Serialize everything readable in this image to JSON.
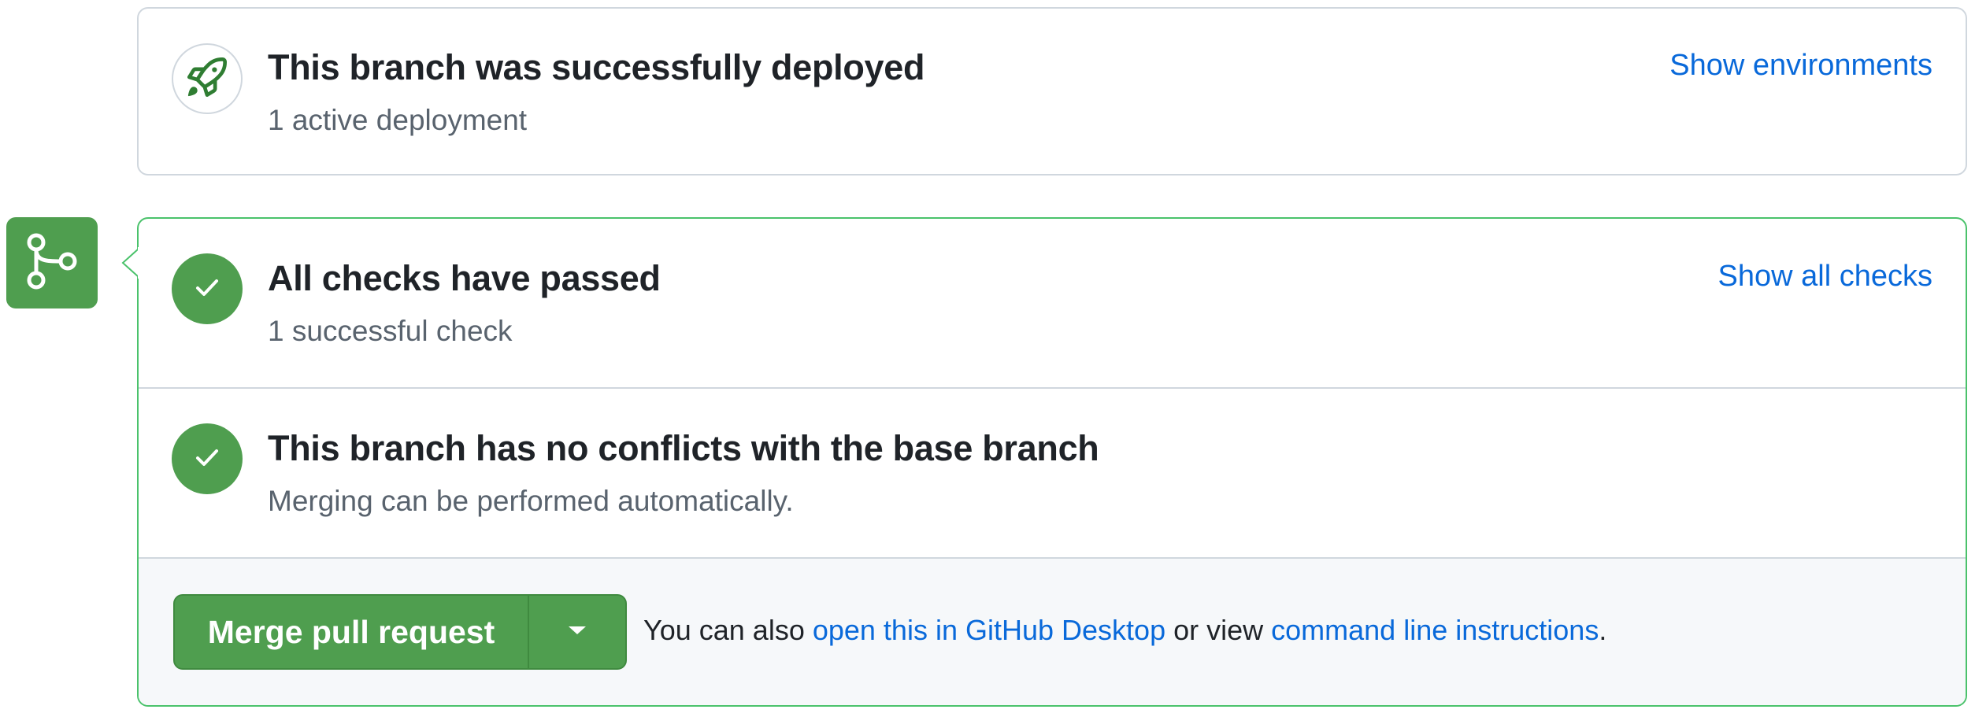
{
  "deployment": {
    "title": "This branch was successfully deployed",
    "subtitle": "1 active deployment",
    "link": "Show environments",
    "icon": "rocket-icon"
  },
  "merge_box": {
    "branch_icon": "git-branch-icon",
    "checks": {
      "title": "All checks have passed",
      "subtitle": "1 successful check",
      "link": "Show all checks",
      "icon": "check-icon"
    },
    "conflicts": {
      "title": "This branch has no conflicts with the base branch",
      "subtitle": "Merging can be performed automatically.",
      "icon": "check-icon"
    },
    "footer": {
      "merge_button_label": "Merge pull request",
      "dropdown_icon": "caret-down-icon",
      "text_prefix": "You can also ",
      "desktop_link": "open this in GitHub Desktop",
      "text_middle": " or view ",
      "cli_link": "command line instructions",
      "text_suffix": "."
    }
  },
  "colors": {
    "success_green": "#4f9e4f",
    "success_border": "#4ac26b",
    "link_blue": "#0969da",
    "muted_text": "#59636e",
    "border_gray": "#d0d7de",
    "footer_bg": "#f6f8fa"
  }
}
